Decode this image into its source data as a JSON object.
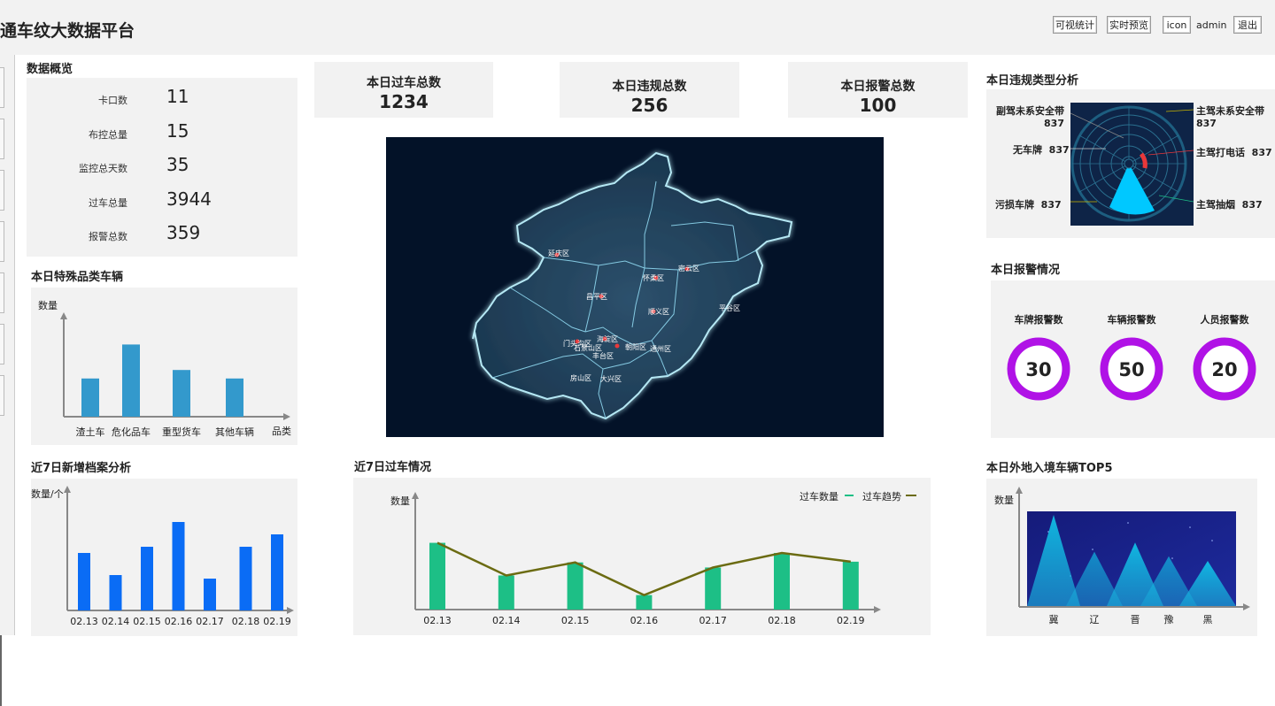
{
  "header": {
    "title": "通车纹大数据平台",
    "buttons": {
      "visual_stats": "可视统计",
      "realtime_preview": "实时预览",
      "icon": "icon",
      "logout": "退出"
    },
    "user": "admin"
  },
  "overview": {
    "title": "数据概览",
    "items": [
      {
        "label": "卡口数",
        "value": "11"
      },
      {
        "label": "布控总量",
        "value": "15"
      },
      {
        "label": "监控总天数",
        "value": "35"
      },
      {
        "label": "过车总量",
        "value": "3944"
      },
      {
        "label": "报警总数",
        "value": "359"
      }
    ]
  },
  "kpis": [
    {
      "label": "本日过车总数",
      "value": "1234"
    },
    {
      "label": "本日违规总数",
      "value": "256"
    },
    {
      "label": "本日报警总数",
      "value": "100"
    }
  ],
  "map": {
    "districts": [
      "延庆区",
      "怀柔区",
      "密云区",
      "昌平区",
      "顺义区",
      "平谷区",
      "门头沟区",
      "海淀区",
      "石景山区",
      "朝阳区",
      "丰台区",
      "通州区",
      "房山区",
      "大兴区"
    ]
  },
  "violation": {
    "title": "本日违规类型分析",
    "labels": [
      {
        "name": "副驾未系安全带",
        "value": "837"
      },
      {
        "name": "无车牌",
        "value": "837"
      },
      {
        "name": "污损车牌",
        "value": "837"
      },
      {
        "name": "主驾未系安全带",
        "value": "837"
      },
      {
        "name": "主驾打电话",
        "value": "837"
      },
      {
        "name": "主驾抽烟",
        "value": "837"
      }
    ],
    "colors": {
      "bg": "#0e2447",
      "accent": "#00c8ff",
      "red": "#e8383a"
    }
  },
  "alarms": {
    "title": "本日报警情况",
    "items": [
      {
        "label": "车牌报警数",
        "value": "30"
      },
      {
        "label": "车辆报警数",
        "value": "50"
      },
      {
        "label": "人员报警数",
        "value": "20"
      }
    ],
    "ring_color": "#b012e6"
  },
  "chart_data": [
    {
      "type": "bar",
      "title": "本日特殊品类车辆",
      "ylabel": "数量",
      "xlabel": "品类",
      "categories": [
        "渣土车",
        "危化品车",
        "重型货车",
        "其他车辆"
      ],
      "values": [
        45,
        85,
        55,
        45
      ],
      "ylim": [
        0,
        100
      ],
      "color": "#3399cc"
    },
    {
      "type": "bar",
      "title": "近7日新增档案分析",
      "ylabel": "数量/个",
      "categories": [
        "02.13",
        "02.14",
        "02.15",
        "02.16",
        "02.17",
        "02.18",
        "02.19"
      ],
      "values": [
        65,
        40,
        72,
        100,
        36,
        72,
        86
      ],
      "ylim": [
        0,
        110
      ],
      "color": "#0a6cf5"
    },
    {
      "type": "bar",
      "title": "近7日过车情况",
      "ylabel": "数量",
      "categories": [
        "02.13",
        "02.14",
        "02.15",
        "02.16",
        "02.17",
        "02.18",
        "02.19"
      ],
      "series": [
        {
          "name": "过车数量",
          "type": "bar",
          "values": [
            92,
            47,
            65,
            20,
            58,
            78,
            66
          ],
          "color": "#1dbf86"
        },
        {
          "name": "过车趋势",
          "type": "line",
          "values": [
            92,
            47,
            65,
            20,
            58,
            78,
            66
          ],
          "color": "#6b6b12"
        }
      ],
      "ylim": [
        0,
        100
      ],
      "legend": "top-right"
    },
    {
      "type": "area",
      "title": "本日外地入境车辆TOP5",
      "ylabel": "数量",
      "categories": [
        "冀",
        "辽",
        "晋",
        "豫",
        "黑"
      ],
      "values": [
        100,
        60,
        70,
        55,
        50
      ],
      "ylim": [
        0,
        100
      ]
    }
  ]
}
